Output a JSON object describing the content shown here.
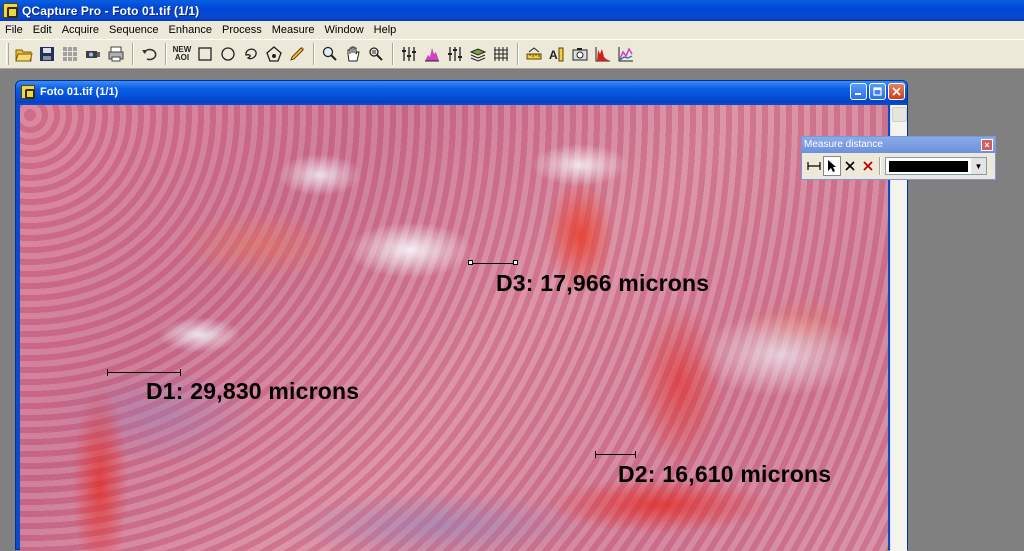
{
  "app": {
    "title": "QCapture Pro - Foto 01.tif (1/1)"
  },
  "menu": [
    "File",
    "Edit",
    "Acquire",
    "Sequence",
    "Enhance",
    "Process",
    "Measure",
    "Window",
    "Help"
  ],
  "toolbar": {
    "new_aoi_label_line1": "NEW",
    "new_aoi_label_line2": "AOI",
    "icons": [
      "open-icon",
      "save-icon",
      "grid-icon",
      "camera-capture-icon",
      "print-icon",
      "undo-icon",
      "new-aoi-icon",
      "rectangle-icon",
      "ellipse-icon",
      "freehand-icon",
      "polygon-icon",
      "pencil-icon",
      "zoom-icon",
      "pan-hand-icon",
      "zoom-region-icon",
      "levels-icon",
      "histogram-icon",
      "curves-icon",
      "layers-icon",
      "grid-overlay-icon",
      "measure-icon",
      "calibrate-icon",
      "snapshot-icon",
      "histogram-red-icon",
      "chart-icon"
    ]
  },
  "image_window": {
    "title": "Foto 01.tif (1/1)"
  },
  "measurements": [
    {
      "id": "D1",
      "label": "D1:  29,830 microns"
    },
    {
      "id": "D2",
      "label": "D2:  16,610 microns"
    },
    {
      "id": "D3",
      "label": "D3:  17,966 microns"
    }
  ],
  "measure_panel": {
    "title": "Measure distance",
    "line_color": "#000000"
  }
}
